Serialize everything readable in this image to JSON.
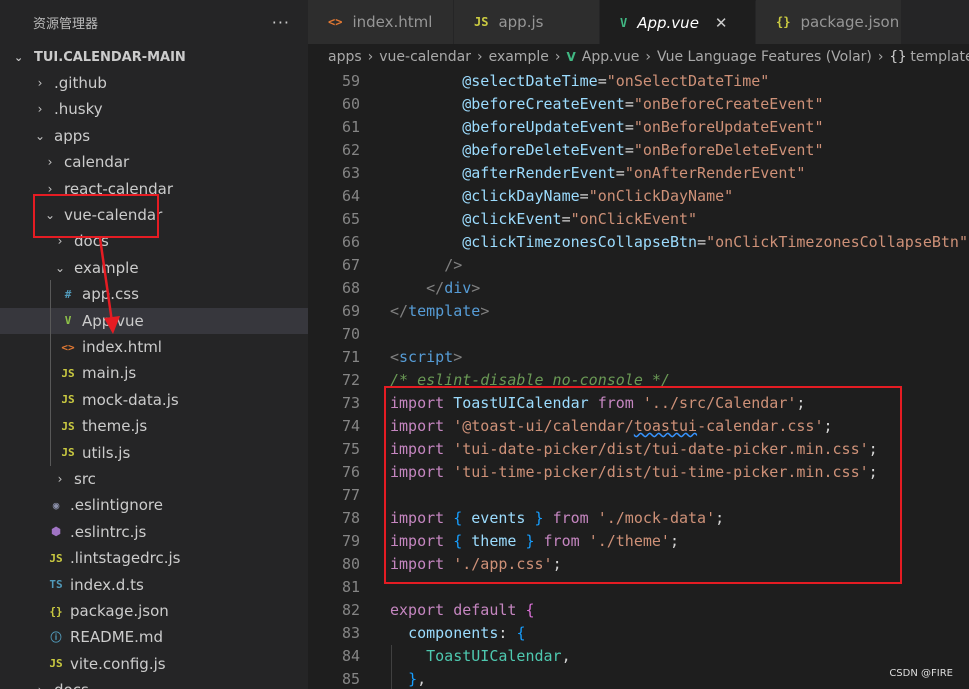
{
  "sidebar": {
    "title": "资源管理器",
    "more": "···",
    "root": "TUI.CALENDAR-MAIN",
    "items": [
      {
        "label": ".github",
        "chev": "›",
        "icon": "",
        "icon_color": ""
      },
      {
        "label": ".husky",
        "chev": "›",
        "icon": "",
        "icon_color": ""
      },
      {
        "label": "apps",
        "chev": "⌄",
        "icon": "",
        "icon_color": ""
      },
      {
        "label": "calendar",
        "chev": "›",
        "icon": "",
        "icon_color": ""
      },
      {
        "label": "react-calendar",
        "chev": "›",
        "icon": "",
        "icon_color": ""
      },
      {
        "label": "vue-calendar",
        "chev": "⌄",
        "icon": "",
        "icon_color": ""
      },
      {
        "label": "docs",
        "chev": "›",
        "icon": "",
        "icon_color": ""
      },
      {
        "label": "example",
        "chev": "⌄",
        "icon": "",
        "icon_color": ""
      },
      {
        "label": "app.css",
        "chev": "",
        "icon": "#",
        "icon_color": "#519aba"
      },
      {
        "label": "App.vue",
        "chev": "",
        "icon": "V",
        "icon_color": "#8dc149"
      },
      {
        "label": "index.html",
        "chev": "",
        "icon": "<>",
        "icon_color": "#e37933"
      },
      {
        "label": "main.js",
        "chev": "",
        "icon": "JS",
        "icon_color": "#cbcb41"
      },
      {
        "label": "mock-data.js",
        "chev": "",
        "icon": "JS",
        "icon_color": "#cbcb41"
      },
      {
        "label": "theme.js",
        "chev": "",
        "icon": "JS",
        "icon_color": "#cbcb41"
      },
      {
        "label": "utils.js",
        "chev": "",
        "icon": "JS",
        "icon_color": "#cbcb41"
      },
      {
        "label": "src",
        "chev": "›",
        "icon": "",
        "icon_color": ""
      },
      {
        "label": ".eslintignore",
        "chev": "",
        "icon": "◉",
        "icon_color": "#8a8fa8"
      },
      {
        "label": ".eslintrc.js",
        "chev": "",
        "icon": "⬢",
        "icon_color": "#a074c4"
      },
      {
        "label": ".lintstagedrc.js",
        "chev": "",
        "icon": "JS",
        "icon_color": "#cbcb41"
      },
      {
        "label": "index.d.ts",
        "chev": "",
        "icon": "TS",
        "icon_color": "#519aba"
      },
      {
        "label": "package.json",
        "chev": "",
        "icon": "{}",
        "icon_color": "#cbcb41"
      },
      {
        "label": "README.md",
        "chev": "",
        "icon": "ⓘ",
        "icon_color": "#519aba"
      },
      {
        "label": "vite.config.js",
        "chev": "",
        "icon": "JS",
        "icon_color": "#cbcb41"
      },
      {
        "label": "docs",
        "chev": "›",
        "icon": "",
        "icon_color": ""
      }
    ]
  },
  "tabs": [
    {
      "label": "index.html",
      "icon": "<>",
      "icon_color": "#e37933",
      "active": false
    },
    {
      "label": "app.js",
      "icon": "JS",
      "icon_color": "#cbcb41",
      "active": false
    },
    {
      "label": "App.vue",
      "icon": "V",
      "icon_color": "#41b883",
      "active": true,
      "close": "✕"
    },
    {
      "label": "package.json",
      "icon": "{}",
      "icon_color": "#cbcb41",
      "active": false
    }
  ],
  "breadcrumb": [
    "apps",
    "vue-calendar",
    "example",
    "App.vue",
    "Vue Language Features (Volar)",
    "template"
  ],
  "code": {
    "line_numbers": [
      "59",
      "60",
      "61",
      "62",
      "63",
      "64",
      "65",
      "66",
      "67",
      "68",
      "69",
      "70",
      "71",
      "72",
      "73",
      "74",
      "75",
      "76",
      "77",
      "78",
      "79",
      "80",
      "81",
      "82",
      "83",
      "84",
      "85"
    ],
    "lines": [
      [
        [
          "        ",
          "k-plain"
        ],
        [
          "@selectDateTime",
          "k-attr"
        ],
        [
          "=",
          "k-plain"
        ],
        [
          "\"onSelectDateTime\"",
          "k-str"
        ]
      ],
      [
        [
          "        ",
          "k-plain"
        ],
        [
          "@beforeCreateEvent",
          "k-attr"
        ],
        [
          "=",
          "k-plain"
        ],
        [
          "\"onBeforeCreateEvent\"",
          "k-str"
        ]
      ],
      [
        [
          "        ",
          "k-plain"
        ],
        [
          "@beforeUpdateEvent",
          "k-attr"
        ],
        [
          "=",
          "k-plain"
        ],
        [
          "\"onBeforeUpdateEvent\"",
          "k-str"
        ]
      ],
      [
        [
          "        ",
          "k-plain"
        ],
        [
          "@beforeDeleteEvent",
          "k-attr"
        ],
        [
          "=",
          "k-plain"
        ],
        [
          "\"onBeforeDeleteEvent\"",
          "k-str"
        ]
      ],
      [
        [
          "        ",
          "k-plain"
        ],
        [
          "@afterRenderEvent",
          "k-attr"
        ],
        [
          "=",
          "k-plain"
        ],
        [
          "\"onAfterRenderEvent\"",
          "k-str"
        ]
      ],
      [
        [
          "        ",
          "k-plain"
        ],
        [
          "@clickDayName",
          "k-attr"
        ],
        [
          "=",
          "k-plain"
        ],
        [
          "\"onClickDayName\"",
          "k-str"
        ]
      ],
      [
        [
          "        ",
          "k-plain"
        ],
        [
          "@clickEvent",
          "k-attr"
        ],
        [
          "=",
          "k-plain"
        ],
        [
          "\"onClickEvent\"",
          "k-str"
        ]
      ],
      [
        [
          "        ",
          "k-plain"
        ],
        [
          "@clickTimezonesCollapseBtn",
          "k-attr"
        ],
        [
          "=",
          "k-plain"
        ],
        [
          "\"onClickTimezonesCollapseBtn\"",
          "k-str"
        ]
      ],
      [
        [
          "      ",
          "k-plain"
        ],
        [
          "/>",
          "k-tag"
        ]
      ],
      [
        [
          "    ",
          "k-plain"
        ],
        [
          "</",
          "k-tag"
        ],
        [
          "div",
          "k-tagname"
        ],
        [
          ">",
          "k-tag"
        ]
      ],
      [
        [
          "</",
          "k-tag"
        ],
        [
          "template",
          "k-tagname"
        ],
        [
          ">",
          "k-tag"
        ]
      ],
      [],
      [
        [
          "<",
          "k-tag"
        ],
        [
          "script",
          "k-tagname"
        ],
        [
          ">",
          "k-tag"
        ]
      ],
      [
        [
          "/* eslint-disable no-console */",
          "k-comment"
        ]
      ],
      [
        [
          "import",
          "k-imp"
        ],
        [
          " ",
          "k-plain"
        ],
        [
          "ToastUICalendar",
          "k-ident"
        ],
        [
          " ",
          "k-plain"
        ],
        [
          "from",
          "k-imp"
        ],
        [
          " ",
          "k-plain"
        ],
        [
          "'../src/Calendar'",
          "k-str"
        ],
        [
          ";",
          "k-plain"
        ]
      ],
      [
        [
          "import",
          "k-imp"
        ],
        [
          " ",
          "k-plain"
        ],
        [
          "'@toast-ui/calendar/",
          "k-str"
        ],
        [
          "toastui",
          "k-str squiggle"
        ],
        [
          "-calendar.css'",
          "k-str"
        ],
        [
          ";",
          "k-plain"
        ]
      ],
      [
        [
          "import",
          "k-imp"
        ],
        [
          " ",
          "k-plain"
        ],
        [
          "'tui-date-picker/dist/tui-date-picker.min.css'",
          "k-str"
        ],
        [
          ";",
          "k-plain"
        ]
      ],
      [
        [
          "import",
          "k-imp"
        ],
        [
          " ",
          "k-plain"
        ],
        [
          "'tui-time-picker/dist/tui-time-picker.min.css'",
          "k-str"
        ],
        [
          ";",
          "k-plain"
        ]
      ],
      [],
      [
        [
          "import",
          "k-imp"
        ],
        [
          " ",
          "k-plain"
        ],
        [
          "{",
          "k-brace2"
        ],
        [
          " events ",
          "k-ident"
        ],
        [
          "}",
          "k-brace2"
        ],
        [
          " ",
          "k-plain"
        ],
        [
          "from",
          "k-imp"
        ],
        [
          " ",
          "k-plain"
        ],
        [
          "'./mock-data'",
          "k-str"
        ],
        [
          ";",
          "k-plain"
        ]
      ],
      [
        [
          "import",
          "k-imp"
        ],
        [
          " ",
          "k-plain"
        ],
        [
          "{",
          "k-brace2"
        ],
        [
          " theme ",
          "k-ident"
        ],
        [
          "}",
          "k-brace2"
        ],
        [
          " ",
          "k-plain"
        ],
        [
          "from",
          "k-imp"
        ],
        [
          " ",
          "k-plain"
        ],
        [
          "'./theme'",
          "k-str"
        ],
        [
          ";",
          "k-plain"
        ]
      ],
      [
        [
          "import",
          "k-imp"
        ],
        [
          " ",
          "k-plain"
        ],
        [
          "'./app.css'",
          "k-str"
        ],
        [
          ";",
          "k-plain"
        ]
      ],
      [],
      [
        [
          "export",
          "k-imp"
        ],
        [
          " ",
          "k-plain"
        ],
        [
          "default",
          "k-imp"
        ],
        [
          " ",
          "k-plain"
        ],
        [
          "{",
          "k-brace"
        ]
      ],
      [
        [
          "  ",
          "k-plain"
        ],
        [
          "components",
          "k-ident"
        ],
        [
          ": ",
          "k-plain"
        ],
        [
          "{",
          "k-brace2"
        ]
      ],
      [
        [
          "    ",
          "k-plain"
        ],
        [
          "ToastUICalendar",
          "k-comp"
        ],
        [
          ",",
          "k-plain"
        ]
      ],
      [
        [
          "  ",
          "k-plain"
        ],
        [
          "}",
          "k-brace2"
        ],
        [
          ",",
          "k-plain"
        ]
      ]
    ]
  },
  "watermark": "CSDN @FIRE"
}
